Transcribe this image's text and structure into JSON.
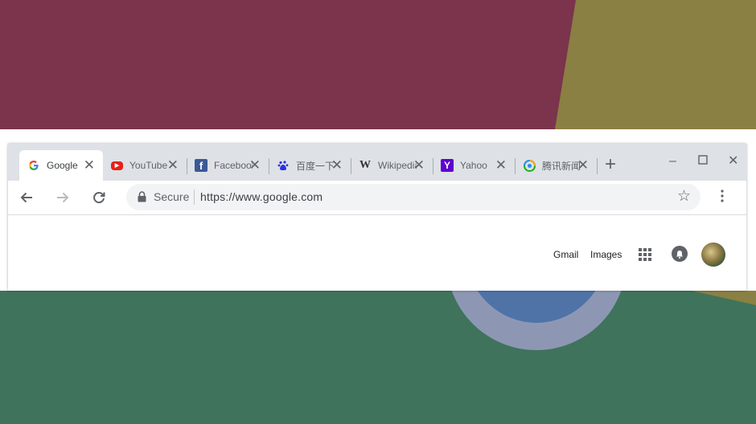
{
  "tabs": [
    {
      "title": "Google",
      "icon": "google-g-icon",
      "color": "#4285f4",
      "active": true
    },
    {
      "title": "YouTube",
      "icon": "youtube-icon",
      "color": "#e62117",
      "active": false
    },
    {
      "title": "Facebook",
      "icon": "facebook-icon",
      "color": "#3b5998",
      "active": false
    },
    {
      "title": "百度一下",
      "icon": "baidu-icon",
      "color": "#2932e1",
      "active": false
    },
    {
      "title": "Wikipedia",
      "icon": "wikipedia-icon",
      "color": "#000000",
      "active": false
    },
    {
      "title": "Yahoo",
      "icon": "yahoo-icon",
      "color": "#5f01d1",
      "active": false
    },
    {
      "title": "腾讯新闻",
      "icon": "tencent-icon",
      "color": "#1aad19",
      "active": false
    }
  ],
  "toolbar": {
    "secure_label": "Secure",
    "url": "https://www.google.com"
  },
  "page": {
    "gmail_link": "Gmail",
    "images_link": "Images"
  },
  "colors": {
    "tabstrip": "#dee1e6",
    "omnibox": "#f1f3f4",
    "icon": "#5f6368"
  }
}
